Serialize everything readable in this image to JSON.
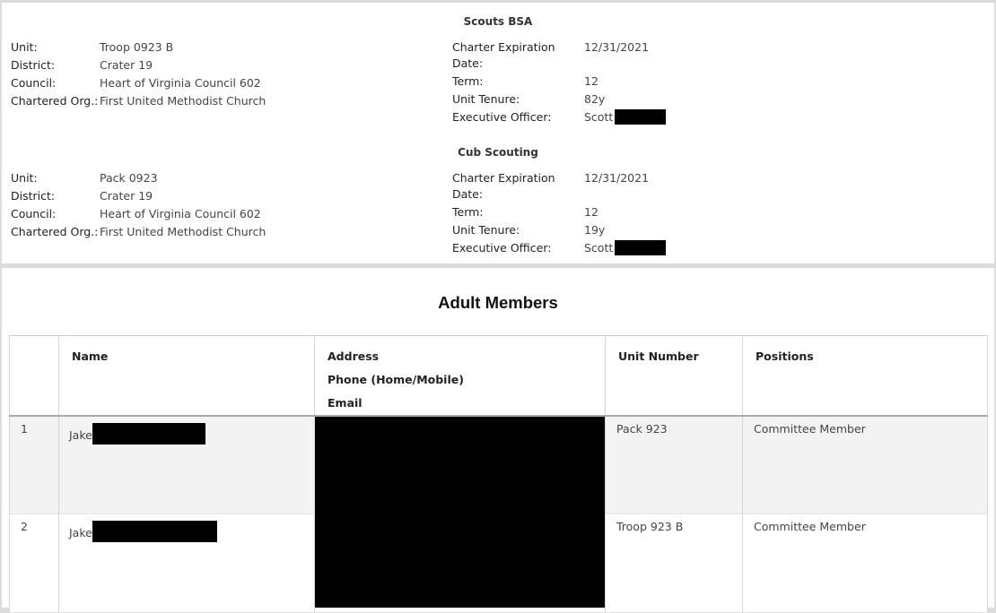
{
  "scouts_bsa": {
    "title": "Scouts BSA",
    "unit_label": "Unit:",
    "unit": "Troop 0923 B",
    "district_label": "District:",
    "district": "Crater 19",
    "council_label": "Council:",
    "council": "Heart of Virginia Council 602",
    "org_label": "Chartered Org.:",
    "org": "First United Methodist Church",
    "charter_label_1": "Charter Expiration",
    "charter_label_2": "Date:",
    "charter": "12/31/2021",
    "term_label": "Term:",
    "term": "12",
    "tenure_label": "Unit Tenure:",
    "tenure": "82y",
    "exec_label": "Executive Officer:",
    "exec": "Scott"
  },
  "cub_scouting": {
    "title": "Cub Scouting",
    "unit_label": "Unit:",
    "unit": "Pack 0923",
    "district_label": "District:",
    "district": "Crater 19",
    "council_label": "Council:",
    "council": "Heart of Virginia Council 602",
    "org_label": "Chartered Org.:",
    "org": "First United Methodist Church",
    "charter_label_1": "Charter Expiration",
    "charter_label_2": "Date:",
    "charter": "12/31/2021",
    "term_label": "Term:",
    "term": "12",
    "tenure_label": "Unit Tenure:",
    "tenure": "19y",
    "exec_label": "Executive Officer:",
    "exec": "Scott"
  },
  "members": {
    "title": "Adult Members",
    "headers": {
      "name": "Name",
      "address": "Address",
      "phone": "Phone (Home/Mobile)",
      "email": "Email",
      "unit_number": "Unit Number",
      "positions": "Positions"
    },
    "rows": [
      {
        "index": "1",
        "name": "Jake",
        "unit_number": "Pack 923",
        "position": "Committee Member"
      },
      {
        "index": "2",
        "name": "Jake",
        "unit_number": "Troop 923 B",
        "position": "Committee Member"
      }
    ]
  }
}
